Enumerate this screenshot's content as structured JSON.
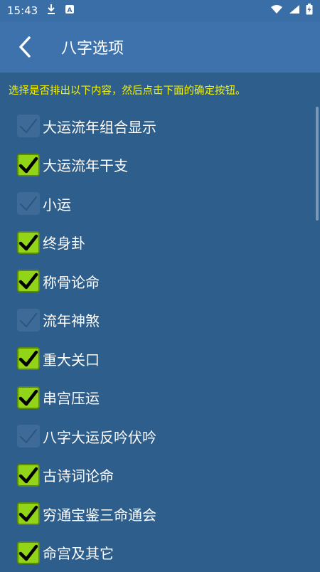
{
  "status": {
    "time": "15:43",
    "icons": [
      "download-icon",
      "a-icon",
      "wifi-icon",
      "signal-icon",
      "battery-icon"
    ]
  },
  "header": {
    "title": "八字选项"
  },
  "instruction": "选择是否排出以下内容，然后点击下面的确定按钮。",
  "options": [
    {
      "label": "大运流年组合显示",
      "checked": false
    },
    {
      "label": "大运流年干支",
      "checked": true
    },
    {
      "label": "小运",
      "checked": false
    },
    {
      "label": "终身卦",
      "checked": true
    },
    {
      "label": "称骨论命",
      "checked": true
    },
    {
      "label": "流年神煞",
      "checked": false
    },
    {
      "label": "重大关口",
      "checked": true
    },
    {
      "label": "串宫压运",
      "checked": true
    },
    {
      "label": "八字大运反吟伏吟",
      "checked": false
    },
    {
      "label": "古诗词论命",
      "checked": true
    },
    {
      "label": "穷通宝鉴三命通会",
      "checked": true
    },
    {
      "label": "命宫及其它",
      "checked": true
    }
  ],
  "colors": {
    "background": "#2e5e8c",
    "appbar": "#3d72ad",
    "instruction": "#f2f200",
    "checkbox_on": "#92d418"
  }
}
